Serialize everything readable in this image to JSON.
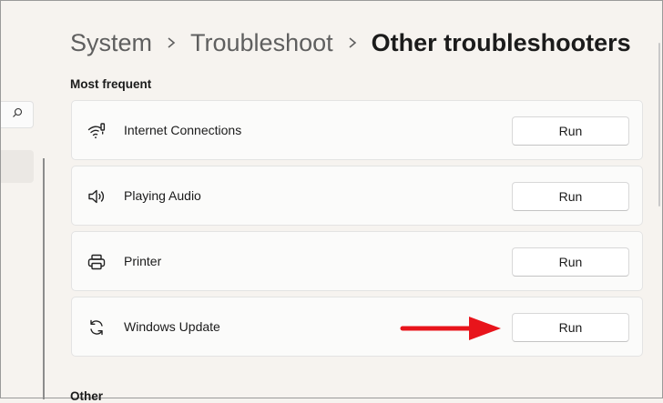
{
  "breadcrumb": {
    "items": [
      "System",
      "Troubleshoot"
    ],
    "current": "Other troubleshooters"
  },
  "sections": {
    "most_frequent": "Most frequent",
    "other": "Other"
  },
  "troubleshooters": [
    {
      "label": "Internet Connections",
      "icon": "wifi-icon",
      "button": "Run"
    },
    {
      "label": "Playing Audio",
      "icon": "speaker-icon",
      "button": "Run"
    },
    {
      "label": "Printer",
      "icon": "printer-icon",
      "button": "Run"
    },
    {
      "label": "Windows Update",
      "icon": "sync-icon",
      "button": "Run"
    }
  ],
  "annotation": {
    "color": "#e8141b",
    "points_to": "Windows Update run button"
  },
  "colors": {
    "background": "#f6f3ef",
    "card": "#fbfbfa",
    "arrow": "#e8141b"
  }
}
